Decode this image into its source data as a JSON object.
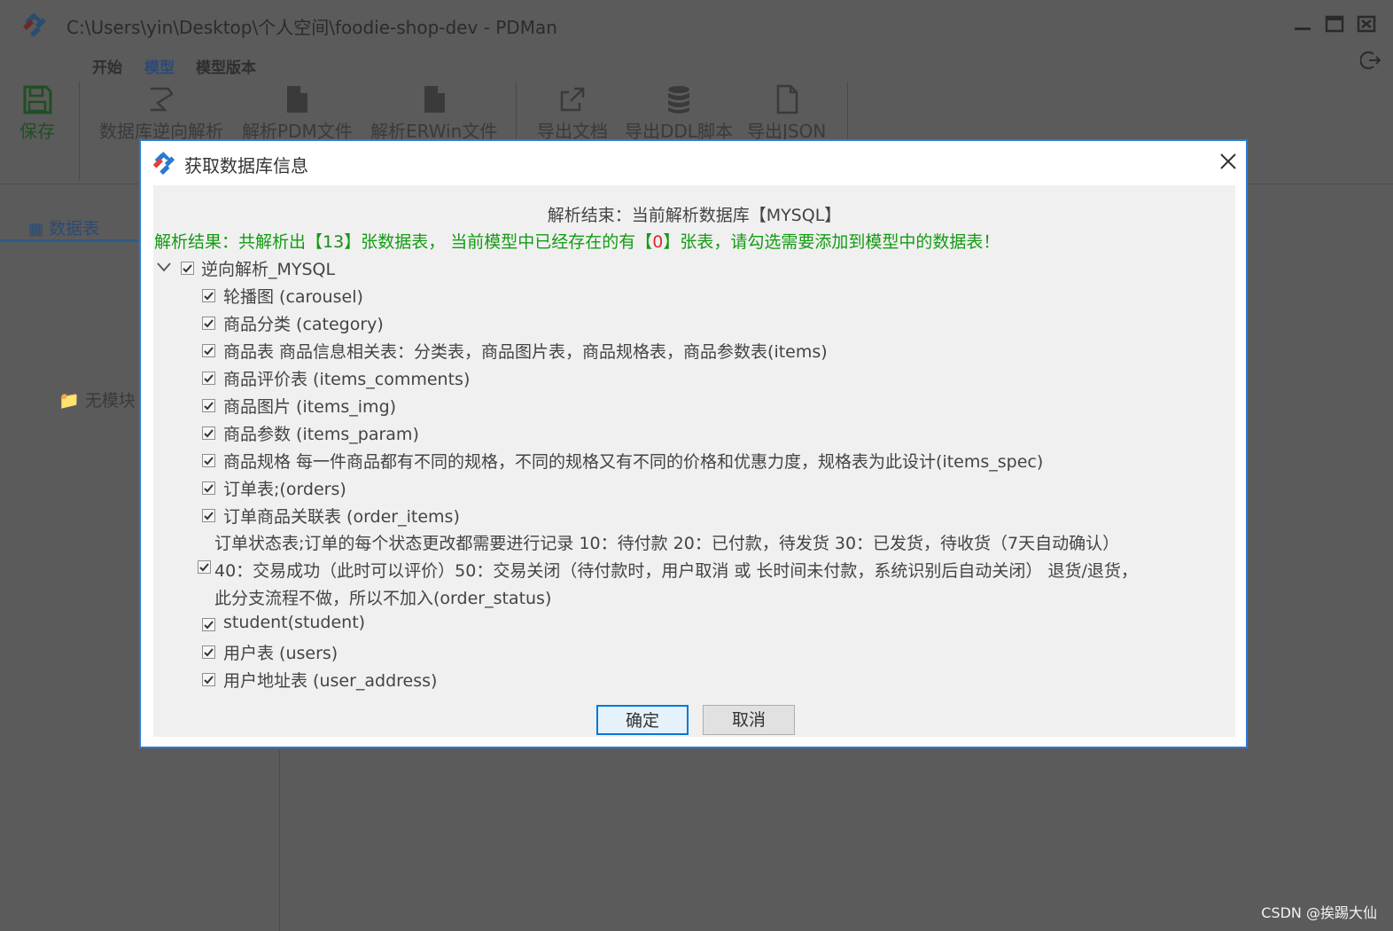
{
  "window": {
    "title": "C:\\Users\\yin\\Desktop\\个人空间\\foodie-shop-dev - PDMan"
  },
  "menu": {
    "tabs": [
      {
        "label": "开始"
      },
      {
        "label": "模型"
      },
      {
        "label": "模型版本"
      }
    ],
    "active_tab": "模型"
  },
  "ribbon": {
    "save": "保存",
    "reverse_db": "数据库逆向解析",
    "parse_pdm": "解析PDM文件",
    "parse_erwin": "解析ERWin文件",
    "export_doc": "导出文档",
    "export_ddl": "导出DDL脚本",
    "export_json": "导出JSON"
  },
  "left_panel": {
    "tab_label": "数据表",
    "empty_text": "无模块"
  },
  "dialog": {
    "title": "获取数据库信息",
    "summary": "解析结束：当前解析数据库【MYSQL】",
    "result_prefix": "解析结果：共解析出【",
    "result_count": "13",
    "result_middle": "】张数据表， 当前模型中已经存在的有【",
    "result_existing": "0",
    "result_suffix": "】张表，请勾选需要添加到模型中的数据表！",
    "tree_root": {
      "label": "逆向解析_MYSQL",
      "checked": true,
      "expanded": true
    },
    "tables": [
      {
        "label": "轮播图 (carousel)",
        "checked": true
      },
      {
        "label": "商品分类 (category)",
        "checked": true
      },
      {
        "label": "商品表 商品信息相关表：分类表，商品图片表，商品规格表，商品参数表(items)",
        "checked": true
      },
      {
        "label": "商品评价表 (items_comments)",
        "checked": true
      },
      {
        "label": "商品图片 (items_img)",
        "checked": true
      },
      {
        "label": "商品参数 (items_param)",
        "checked": true
      },
      {
        "label": "商品规格 每一件商品都有不同的规格，不同的规格又有不同的价格和优惠力度，规格表为此设计(items_spec)",
        "checked": true
      },
      {
        "label": "订单表;(orders)",
        "checked": true
      },
      {
        "label": "订单商品关联表 (order_items)",
        "checked": true
      }
    ],
    "order_status_item": {
      "line1": "订单状态表;订单的每个状态更改都需要进行记录 10：待付款 20：已付款，待发货 30：已发货，待收货（7天自动确认）",
      "line2": "40：交易成功（此时可以评价）50：交易关闭（待付款时，用户取消 或 长时间未付款，系统识别后自动关闭） 退货/退货，",
      "line3": "此分支流程不做，所以不加入(order_status)",
      "checked": true
    },
    "tables_after": [
      {
        "label": "student(student)",
        "checked": true
      },
      {
        "label": "用户表 (users)",
        "checked": true
      },
      {
        "label": "用户地址表 (user_address)",
        "checked": true
      }
    ],
    "ok_button": "确定",
    "cancel_button": "取消"
  },
  "watermark": "CSDN @挨踢大仙",
  "colors": {
    "overlay_bg": "#5b5b5b",
    "dialog_border": "#2c7ad6",
    "result_green": "#149b14",
    "highlight_red": "#e02a2a",
    "ok_border": "#0078d7"
  }
}
